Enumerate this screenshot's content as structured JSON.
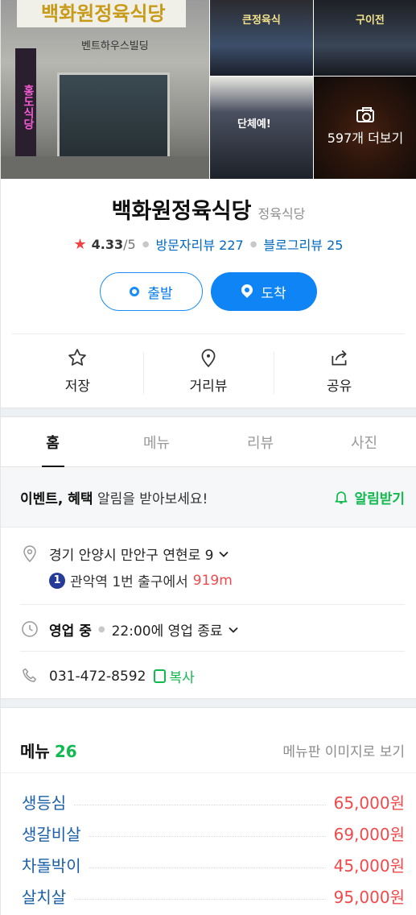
{
  "photos": {
    "main_sign": "백화원정육식당",
    "main_sign_highlight": "정육",
    "main_sub_sign": "벤트하우스빌딩",
    "main_banner": "홍도식당",
    "neon_1": "큰정육식",
    "neon_2": "구이전",
    "neon_3": "단체예!",
    "more_label": "597개 더보기"
  },
  "place": {
    "name": "백화원정육식당",
    "category": "정육식당",
    "rating": "4.33",
    "rating_max": "/5",
    "visitor_reviews": "방문자리뷰 227",
    "blog_reviews": "블로그리뷰 25"
  },
  "buttons": {
    "start": "출발",
    "arrive": "도착"
  },
  "actions": {
    "save": "저장",
    "streetview": "거리뷰",
    "share": "공유"
  },
  "tabs": [
    "홈",
    "메뉴",
    "리뷰",
    "사진"
  ],
  "alert": {
    "bold": "이벤트, 혜택",
    "text": " 알림을 받아보세요!",
    "button": "알림받기"
  },
  "info": {
    "address": "경기 안양시 만안구 연현로 9",
    "subway_line": "1",
    "subway_text": "관악역 1번 출구에서",
    "subway_distance": "919m",
    "hours_status": "영업 중",
    "hours_text": "22:00에 영업 종료",
    "phone": "031-472-8592",
    "copy_label": "복사"
  },
  "menu": {
    "title": "메뉴",
    "count": "26",
    "board_link": "메뉴판 이미지로 보기",
    "items": [
      {
        "name": "생등심",
        "price": "65,000원"
      },
      {
        "name": "생갈비살",
        "price": "69,000원"
      },
      {
        "name": "차돌박이",
        "price": "45,000원"
      },
      {
        "name": "살치살",
        "price": "95,000원"
      }
    ]
  },
  "colors": {
    "blue_primary": "#0f84f5",
    "link_blue": "#0068c3",
    "green": "#12b94f",
    "red_price": "#f2494b",
    "star_red": "#f14141"
  }
}
